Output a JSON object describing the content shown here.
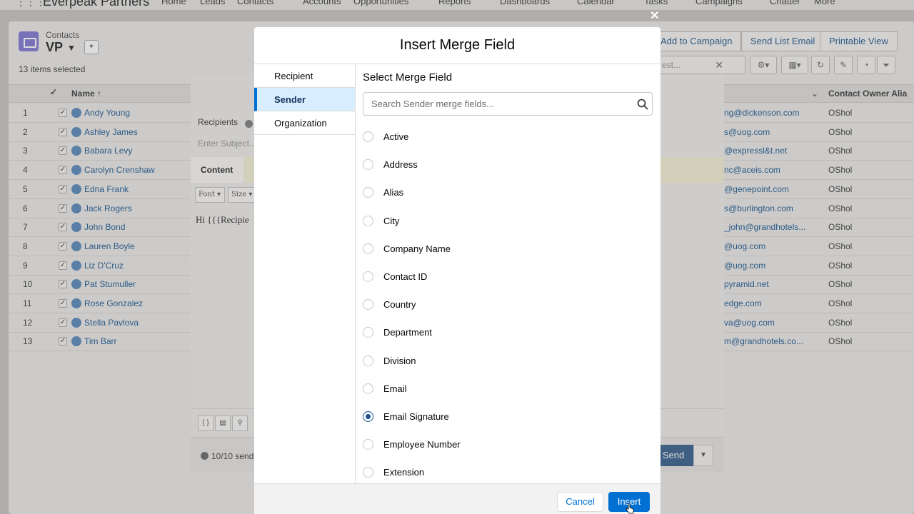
{
  "app": {
    "name": "Everpeak Partners",
    "nav_tabs": [
      "Home",
      "Leads",
      "Contacts",
      "Accounts",
      "Opportunities",
      "Reports",
      "Dashboards",
      "Calendar",
      "Tasks",
      "Campaigns",
      "Chatter",
      "More"
    ]
  },
  "list_view": {
    "object_label": "Contacts",
    "view_name": "VP",
    "selected_text": "13 items selected",
    "actions": [
      "Add to Campaign",
      "Send List Email",
      "Printable View"
    ],
    "search_value": "est...",
    "columns": [
      "Name",
      "Contact Owner Alia"
    ],
    "rows": [
      {
        "num": "1",
        "name": "Andy Young",
        "email": "ng@dickenson.com",
        "owner": "OShol"
      },
      {
        "num": "2",
        "name": "Ashley James",
        "email": "s@uog.com",
        "owner": "OShol"
      },
      {
        "num": "3",
        "name": "Babara Levy",
        "email": "@expressl&t.net",
        "owner": "OShol"
      },
      {
        "num": "4",
        "name": "Carolyn Crenshaw",
        "email": "nc@aceis.com",
        "owner": "OShol"
      },
      {
        "num": "5",
        "name": "Edna Frank",
        "email": "@genepoint.com",
        "owner": "OShol"
      },
      {
        "num": "6",
        "name": "Jack Rogers",
        "email": "s@burlington.com",
        "owner": "OShol"
      },
      {
        "num": "7",
        "name": "John Bond",
        "email": "_john@grandhotels...",
        "owner": "OShol"
      },
      {
        "num": "8",
        "name": "Lauren Boyle",
        "email": "@uog.com",
        "owner": "OShol"
      },
      {
        "num": "9",
        "name": "Liz D'Cruz",
        "email": "@uog.com",
        "owner": "OShol"
      },
      {
        "num": "10",
        "name": "Pat Stumuller",
        "email": "pyramid.net",
        "owner": "OShol"
      },
      {
        "num": "11",
        "name": "Rose Gonzalez",
        "email": "edge.com",
        "owner": "OShol"
      },
      {
        "num": "12",
        "name": "Stella Pavlova",
        "email": "va@uog.com",
        "owner": "OShol"
      },
      {
        "num": "13",
        "name": "Tim Barr",
        "email": "m@grandhotels.co...",
        "owner": "OShol"
      }
    ]
  },
  "composer": {
    "recipients_label": "Recipients",
    "subject_placeholder": "Enter Subject...",
    "content_tab": "Content",
    "font_label": "Font",
    "size_label": "Size",
    "body_text": "Hi {{{Recipie",
    "sends_text": "10/10 send",
    "send_label": "Send"
  },
  "modal": {
    "title": "Insert Merge Field",
    "nav_items": [
      {
        "label": "Recipient",
        "active": false
      },
      {
        "label": "Sender",
        "active": true
      },
      {
        "label": "Organization",
        "active": false
      }
    ],
    "section_title": "Select Merge Field",
    "search_placeholder": "Search Sender merge fields...",
    "fields": [
      {
        "label": "Active",
        "checked": false
      },
      {
        "label": "Address",
        "checked": false
      },
      {
        "label": "Alias",
        "checked": false
      },
      {
        "label": "City",
        "checked": false
      },
      {
        "label": "Company Name",
        "checked": false
      },
      {
        "label": "Contact ID",
        "checked": false
      },
      {
        "label": "Country",
        "checked": false
      },
      {
        "label": "Department",
        "checked": false
      },
      {
        "label": "Division",
        "checked": false
      },
      {
        "label": "Email",
        "checked": false
      },
      {
        "label": "Email Signature",
        "checked": true
      },
      {
        "label": "Employee Number",
        "checked": false
      },
      {
        "label": "Extension",
        "checked": false
      }
    ],
    "cancel_label": "Cancel",
    "insert_label": "Insert"
  },
  "colors": {
    "brand_blue": "#0070d2",
    "selected_radio": "#1b5297",
    "active_nav_bg": "#d8edff"
  }
}
